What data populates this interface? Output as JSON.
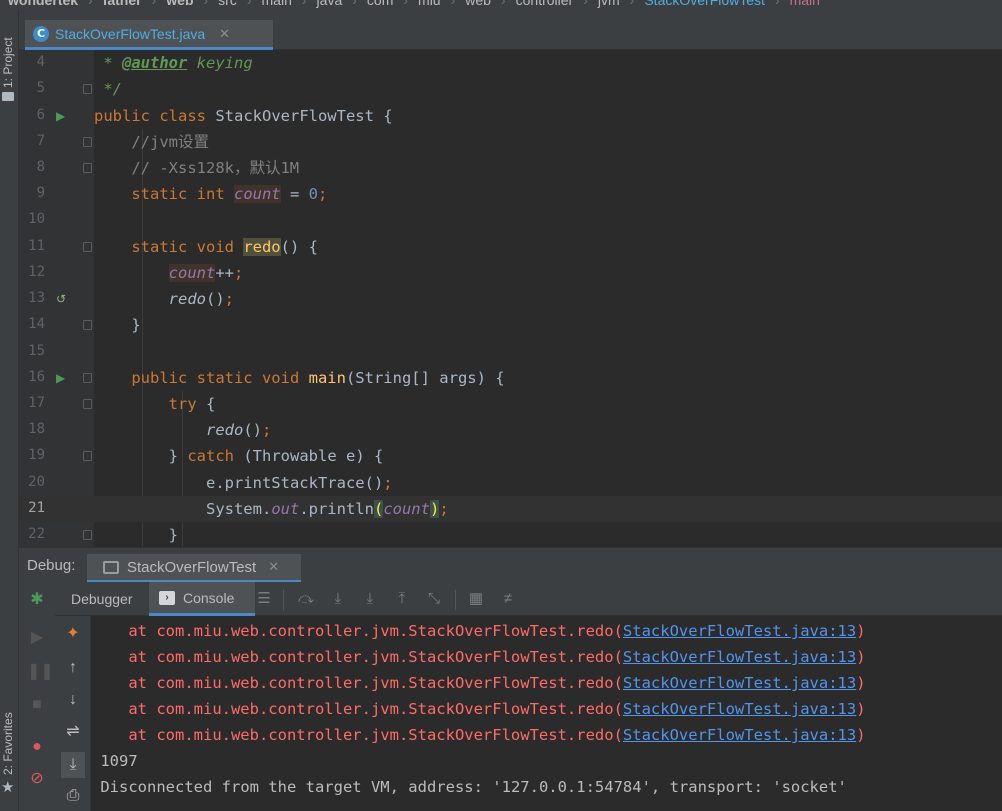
{
  "breadcrumb": [
    "wondertek",
    "father",
    "web",
    "src",
    "main",
    "java",
    "com",
    "miu",
    "web",
    "controller",
    "jvm",
    "StackOverFlowTest",
    "main"
  ],
  "left_stripe": {
    "project_label": "1: Project",
    "favorites_label": "2: Favorites"
  },
  "editor_tab": {
    "title": "StackOverFlowTest.java",
    "icon": "class-c-icon"
  },
  "gutter": [
    "4",
    "5",
    "6",
    "7",
    "8",
    "9",
    "10",
    "11",
    "12",
    "13",
    "14",
    "15",
    "16",
    "17",
    "18",
    "19",
    "20",
    "21",
    "22"
  ],
  "code": {
    "l4_prefix": " * ",
    "l4_tag": "@author",
    "l4_text": " keying",
    "l5": " */",
    "l6_kw": "public class ",
    "l6_name": "StackOverFlowTest {",
    "l7": "    //jvm设置",
    "l8": "    // -Xss128k，默认1M",
    "l9_kw": "    static int ",
    "l9_field": "count",
    "l9_eq": " = ",
    "l9_val": "0",
    "l9_end": ";",
    "l11_kw": "    static void ",
    "l11_fn": "redo",
    "l11_rest": "() {",
    "l12_field": "count",
    "l12_rest": "++",
    "l12_end": ";",
    "l13_call": "redo",
    "l13_rest": "()",
    "l13_end": ";",
    "l14": "    }",
    "l16_kw": "    public static void ",
    "l16_fn": "main",
    "l16_rest": "(String[] args) {",
    "l17_kw": "try",
    "l17_rest": " {",
    "l18_call": "redo",
    "l18_rest": "()",
    "l18_end": ";",
    "l19_a": "} ",
    "l19_kw": "catch",
    "l19_rest": " (Throwable e) {",
    "l20_a": "e.printStackTrace()",
    "l20_end": ";",
    "l21_a": "System.",
    "l21_out": "out",
    "l21_b": ".println",
    "l21_po": "(",
    "l21_arg": "count",
    "l21_pc": ")",
    "l21_end": ";",
    "l22": "}"
  },
  "debug": {
    "label": "Debug:",
    "session_tab": "StackOverFlowTest",
    "subtabs": {
      "debugger": "Debugger",
      "console": "Console"
    }
  },
  "console": {
    "trace_at": "at com.miu.web.controller.jvm.StackOverFlowTest.redo(",
    "trace_link": "StackOverFlowTest.java:13",
    "trace_close": ")",
    "output_count": "1097",
    "disconnect": "Disconnected from the target VM, address: '127.0.0.1:54784', transport: 'socket'"
  },
  "colors": {
    "accent": "#4a88c7",
    "error": "#ff6b68",
    "link": "#5394ec",
    "keyword": "#cc7832"
  }
}
